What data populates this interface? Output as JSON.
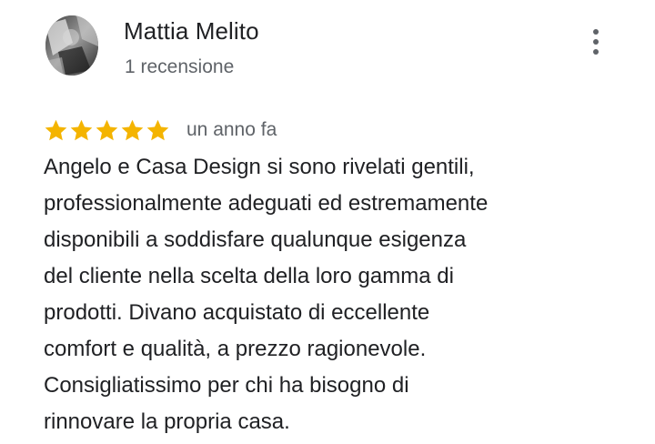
{
  "review": {
    "author_name": "Mattia Melito",
    "review_count": "1 recensione",
    "rating": 5,
    "rating_max": 5,
    "date": "un anno fa",
    "text_lines": [
      "Angelo e Casa Design si sono rivelati gentili,",
      "professionalmente adeguati ed estremamente",
      "disponibili a soddisfare qualunque esigenza",
      "del cliente nella scelta della loro gamma di",
      "prodotti. Divano acquistato di eccellente",
      "comfort e qualità, a prezzo ragionevole.",
      "Consigliatissimo per chi ha bisogno di",
      "rinnovare la propria casa."
    ]
  },
  "icons": {
    "more": "more-vert-icon",
    "star": "star-icon"
  },
  "colors": {
    "star": "#f4b400",
    "text_primary": "#202124",
    "text_secondary": "#5f6368"
  }
}
